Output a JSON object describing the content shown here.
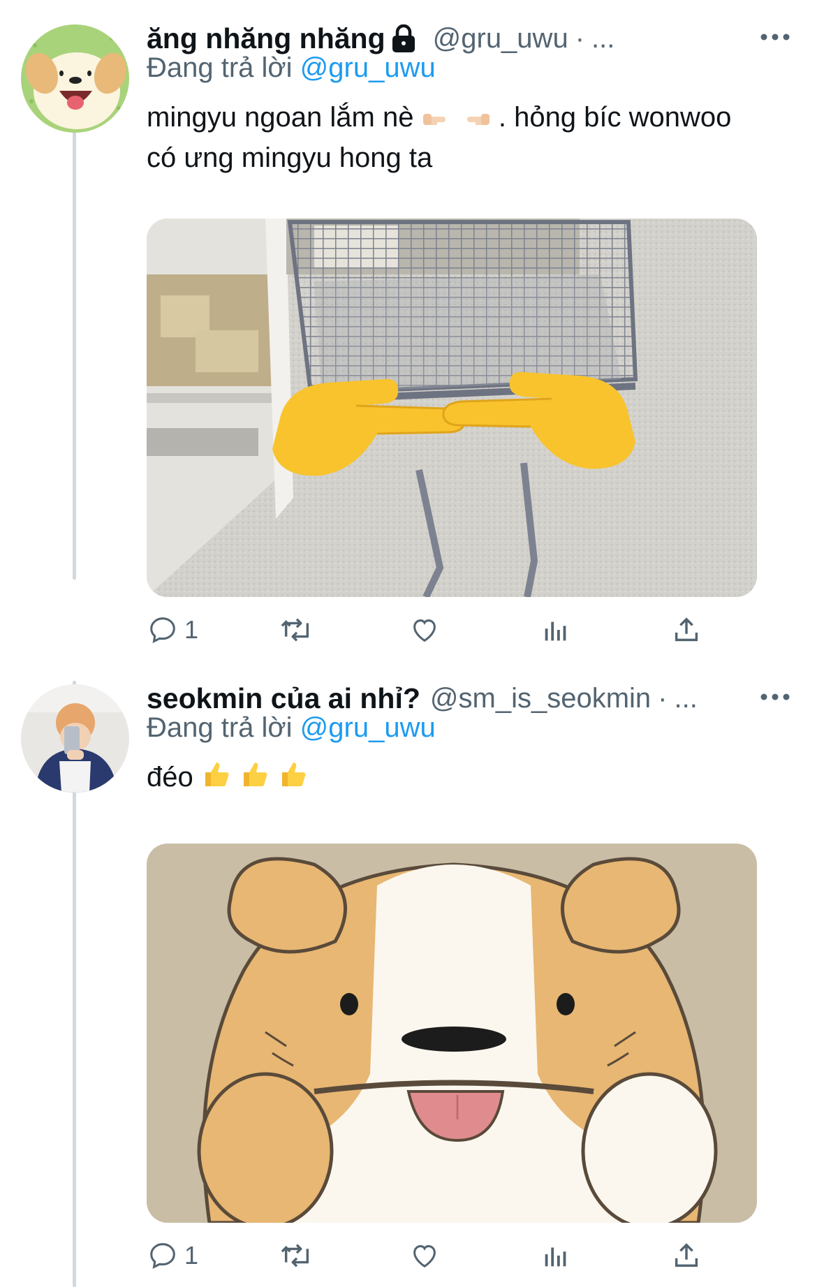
{
  "tweets": [
    {
      "display_name": "ăng nhăng nhăng",
      "handle": "@gru_uwu",
      "separator": "·",
      "ellipsis": "...",
      "locked": true,
      "replying_prefix": "Đang trả lời",
      "replying_to": "@gru_uwu",
      "text_line1_a": "mingyu ngoan lắm nè",
      "text_line1_b": ". hỏng bíc wonwoo",
      "text_line2": "có ưng mingyu hong ta",
      "media_desc": "shopping-cart-pointing-fingers",
      "reply_count": "1",
      "icons": [
        "reply-icon",
        "retweet-icon",
        "like-icon",
        "analytics-icon",
        "share-icon"
      ]
    },
    {
      "display_name": "seokmin của ai nhỉ?",
      "handle": "@sm_is_seokmin",
      "separator": "·",
      "ellipsis": "...",
      "locked": false,
      "replying_prefix": "Đang trả lời",
      "replying_to": "@gru_uwu",
      "text": "đéo",
      "media_desc": "cartoon-puppy-tongue-out",
      "reply_count": "1",
      "icons": [
        "reply-icon",
        "retweet-icon",
        "like-icon",
        "analytics-icon",
        "share-icon"
      ]
    }
  ],
  "colors": {
    "link": "#1d9bf0",
    "secondary_text": "#536471",
    "thread_line": "#cfd9de",
    "emoji_yellow": "#f4c430"
  }
}
